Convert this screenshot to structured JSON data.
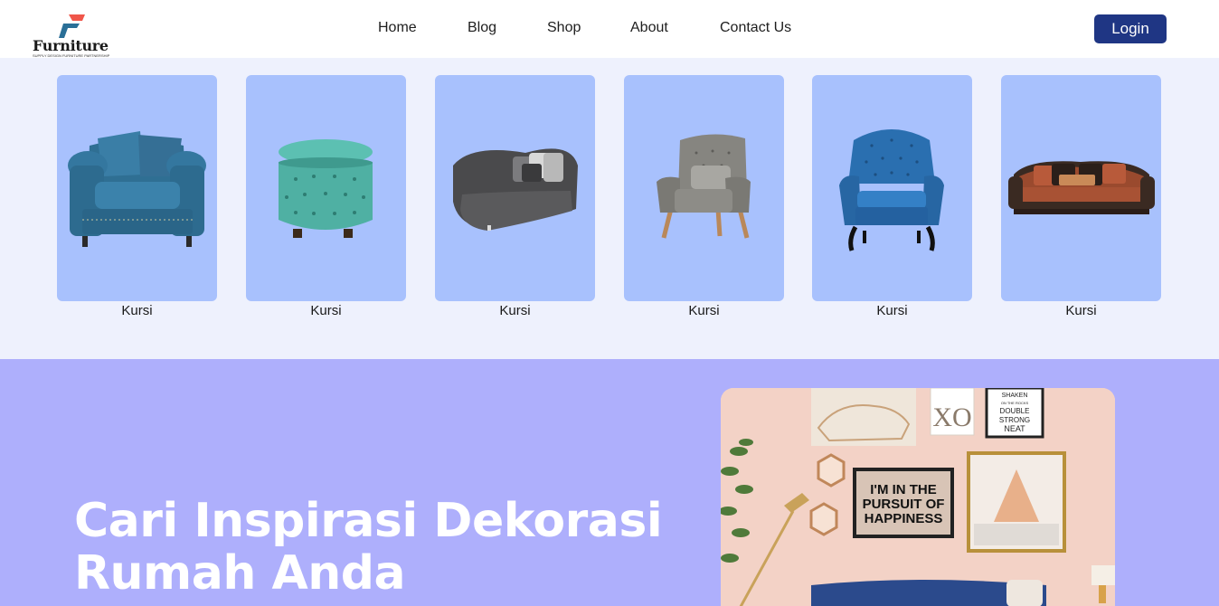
{
  "header": {
    "logo_text": "Furniture",
    "logo_tagline": "SUPPLY DESIGN FURNITURE PARTNERSHIP",
    "nav": [
      {
        "label": "Home"
      },
      {
        "label": "Blog"
      },
      {
        "label": "Shop"
      },
      {
        "label": "About"
      },
      {
        "label": "Contact Us"
      }
    ],
    "login_label": "Login"
  },
  "products": {
    "items": [
      {
        "label": "Kursi",
        "image": "blue-armchair-image"
      },
      {
        "label": "Kursi",
        "image": "teal-ottoman-image"
      },
      {
        "label": "Kursi",
        "image": "grey-curved-sofa-image"
      },
      {
        "label": "Kursi",
        "image": "grey-armchair-image"
      },
      {
        "label": "Kursi",
        "image": "blue-wingback-chair-image"
      },
      {
        "label": "Kursi",
        "image": "brown-sofa-image"
      }
    ]
  },
  "hero": {
    "title_line1": "Cari Inspirasi Dekorasi",
    "title_line2": "Rumah Anda",
    "image": "living-room-decor-image",
    "poster_xo": "XO",
    "poster_quote": "I'M IN THE PURSUIT OF HAPPINESS",
    "poster_shaken": "SHAKEN ON THE ROCKS DOUBLE STRONG NEAT"
  },
  "colors": {
    "login_button": "#1f3684",
    "product_bg": "#eef1fd",
    "card_bg": "#a8c1fd",
    "hero_bg": "#aeaffc"
  }
}
